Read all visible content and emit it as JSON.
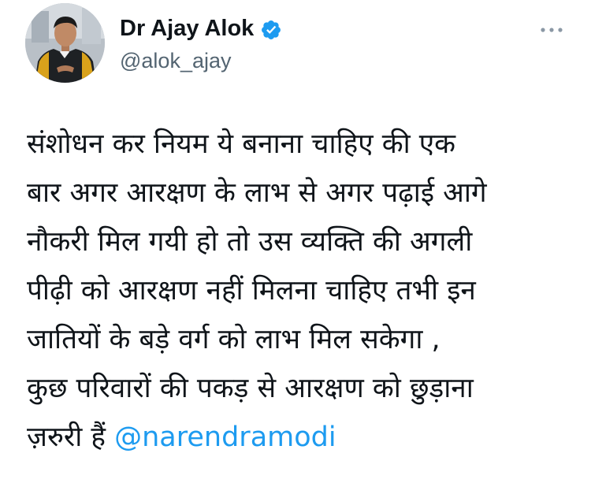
{
  "author": {
    "display_name": "Dr Ajay Alok",
    "handle": "@alok_ajay",
    "verified": true
  },
  "icons": {
    "verified": "verified-badge-icon",
    "more": "more-horizontal-icon"
  },
  "tweet": {
    "lines": [
      "संशोधन कर नियम ये बनाना चाहिए की एक",
      "बार अगर आरक्षण के लाभ से अगर पढ़ाई आगे",
      "नौकरी मिल गयी हो तो उस व्यक्ति की अगली",
      "पीढ़ी को आरक्षण नहीं मिलना चाहिए तभी इन",
      "जातियों के बड़े वर्ग को लाभ मिल सकेगा ,",
      "कुछ परिवारों की पकड़ से आरक्षण को छुड़ाना"
    ],
    "last_line_text": "ज़रुरी हैं ",
    "mention": "@narendramodi"
  },
  "colors": {
    "text": "#0f1419",
    "secondary": "#536471",
    "link": "#1d9bf0",
    "verified": "#1d9bf0"
  }
}
